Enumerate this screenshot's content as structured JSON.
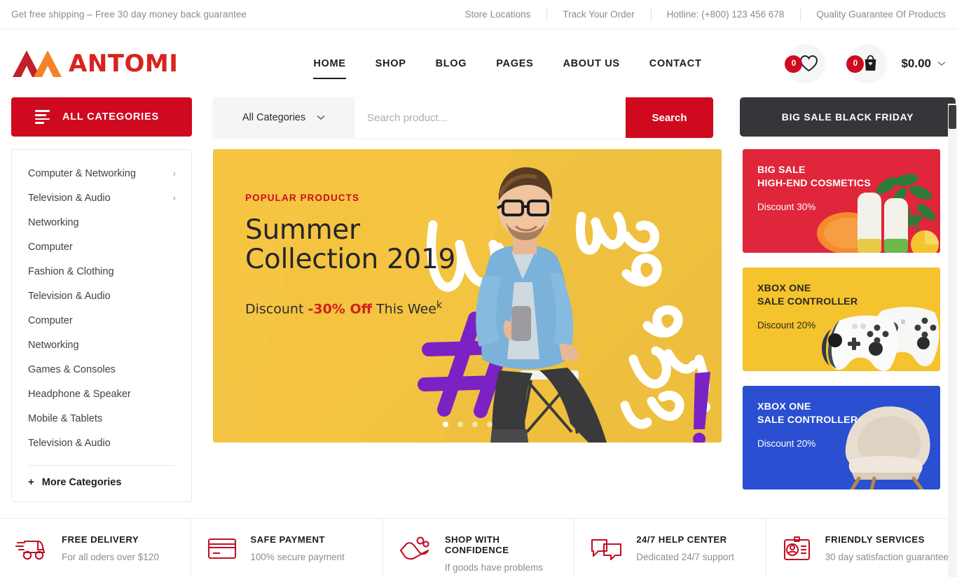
{
  "topbar": {
    "promo": "Get free shipping  – Free 30 day money back guarantee",
    "links": [
      "Store Locations",
      "Track Your Order",
      "Hotline: (+800) 123 456 678",
      "Quality Guarantee Of Products"
    ]
  },
  "header": {
    "brand": "ANTOMI",
    "nav": [
      {
        "label": "HOME",
        "active": true
      },
      {
        "label": "SHOP",
        "active": false
      },
      {
        "label": "BLOG",
        "active": false
      },
      {
        "label": "PAGES",
        "active": false
      },
      {
        "label": "ABOUT US",
        "active": false
      },
      {
        "label": "CONTACT",
        "active": false
      }
    ],
    "wishlist_count": "0",
    "cart_count": "0",
    "cart_total": "$0.00"
  },
  "search": {
    "all_categories_button": "ALL CATEGORIES",
    "category_select": "All Categories",
    "placeholder": "Search product...",
    "value": "",
    "button": "Search",
    "black_friday": "BIG SALE BLACK FRIDAY"
  },
  "sidebar": {
    "items": [
      {
        "label": "Computer & Networking",
        "has_sub": true
      },
      {
        "label": "Television & Audio",
        "has_sub": true
      },
      {
        "label": "Networking",
        "has_sub": false
      },
      {
        "label": "Computer",
        "has_sub": false
      },
      {
        "label": "Fashion & Clothing",
        "has_sub": false
      },
      {
        "label": "Television & Audio",
        "has_sub": false
      },
      {
        "label": "Computer",
        "has_sub": false
      },
      {
        "label": "Networking",
        "has_sub": false
      },
      {
        "label": "Games & Consoles",
        "has_sub": false
      },
      {
        "label": "Headphone & Speaker",
        "has_sub": false
      },
      {
        "label": "Mobile & Tablets",
        "has_sub": false
      },
      {
        "label": "Television & Audio",
        "has_sub": false
      }
    ],
    "more_label": "More Categories",
    "more_plus": "+"
  },
  "hero": {
    "kicker": "POPULAR PRODUCTS",
    "title_line1": "Summer",
    "title_line2": "Collection 2019",
    "discount_prefix": "Discount",
    "discount_value": "-30% Off",
    "discount_suffix": "This Wee",
    "discount_suffix_sup": "k",
    "dots": 4,
    "active_dot": 0
  },
  "promos": [
    {
      "title_line1": "BIG SALE",
      "title_line2": "HIGH-END COSMETICS",
      "discount": "Discount 30%",
      "color": "#e0263b",
      "style": "red"
    },
    {
      "title_line1": "XBOX ONE",
      "title_line2": "SALE CONTROLLER",
      "discount": "Discount 20%",
      "color": "#f5c32e",
      "style": "yellow"
    },
    {
      "title_line1": "XBOX ONE",
      "title_line2": "SALE CONTROLLER",
      "discount": "Discount 20%",
      "color": "#2a4fd0",
      "style": "blue"
    }
  ],
  "features": [
    {
      "icon": "delivery-truck-icon",
      "title": "FREE DELIVERY",
      "desc": "For all oders over $120"
    },
    {
      "icon": "credit-card-icon",
      "title": "SAFE PAYMENT",
      "desc": "100% secure payment"
    },
    {
      "icon": "hand-shield-icon",
      "title": "SHOP WITH CONFIDENCE",
      "desc": "If goods have problems"
    },
    {
      "icon": "chat-bubbles-icon",
      "title": "24/7 HELP CENTER",
      "desc": "Dedicated 24/7 support"
    },
    {
      "icon": "id-card-icon",
      "title": "FRIENDLY SERVICES",
      "desc": "30 day satisfaction guarantee"
    }
  ],
  "colors": {
    "brand_red": "#cf0a1e",
    "logo_red": "#d8231f",
    "logo_orange": "#f5822a",
    "dark": "#36363a",
    "hero_yellow": "#f3c443"
  }
}
